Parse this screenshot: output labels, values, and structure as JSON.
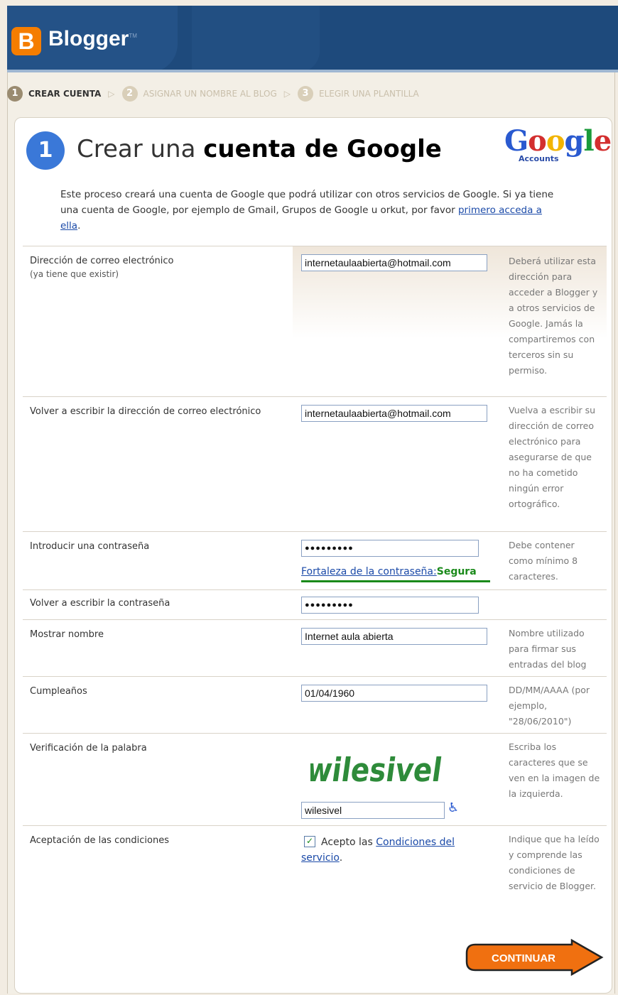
{
  "header": {
    "brand": "Blogger",
    "brand_tm": "TM",
    "logo_letter": "B"
  },
  "steps": [
    {
      "num": "1",
      "label": "CREAR CUENTA"
    },
    {
      "num": "2",
      "label": "ASIGNAR UN NOMBRE AL BLOG"
    },
    {
      "num": "3",
      "label": "ELEGIR UNA PLANTILLA"
    }
  ],
  "page": {
    "step_badge": "1",
    "title_prefix": "Crear una ",
    "title_bold": "cuenta de Google",
    "google_logo": "Google",
    "google_accounts": "Accounts",
    "intro_text": "Este proceso creará una cuenta de Google que podrá utilizar con otros servicios de Google. Si ya tiene una cuenta de Google, por ejemplo de Gmail, Grupos de Google u orkut, por favor ",
    "intro_link": "primero acceda a ella",
    "intro_end": "."
  },
  "form": {
    "email": {
      "label": "Dirección de correo electrónico",
      "sublabel": "(ya tiene que existir)",
      "value": "internetaulaabierta@hotmail.com",
      "help": "Deberá utilizar esta dirección para acceder a Blogger y a otros servicios de Google. Jamás la compartiremos con terceros sin su permiso."
    },
    "email_confirm": {
      "label": "Volver a escribir la dirección de correo electrónico",
      "value": "internetaulaabierta@hotmail.com",
      "help": "Vuelva a escribir su dirección de correo electrónico para asegurarse de que no ha cometido ningún error ortográfico."
    },
    "password": {
      "label": "Introducir una contraseña",
      "value": "●●●●●●●●●",
      "strength_label": "Fortaleza de la contraseña:",
      "strength_value": "Segura",
      "help": "Debe contener como mínimo 8 caracteres."
    },
    "password_confirm": {
      "label": "Volver a escribir la contraseña",
      "value": "●●●●●●●●●"
    },
    "display_name": {
      "label": "Mostrar nombre",
      "value": "Internet aula abierta",
      "help": "Nombre utilizado para firmar sus entradas del blog"
    },
    "birthday": {
      "label": "Cumpleaños",
      "value": "01/04/1960",
      "help": "DD/MM/AAAA (por ejemplo, \"28/06/2010\")"
    },
    "captcha": {
      "label": "Verificación de la palabra",
      "image_text": "wilesivel",
      "value": "wilesivel",
      "help": "Escriba los caracteres que se ven en la imagen de la izquierda."
    },
    "terms": {
      "label": "Aceptación de las condiciones",
      "accept_text": "Acepto las ",
      "terms_link": "Condiciones del servicio",
      "accept_end": ".",
      "checked": true,
      "help": "Indique que ha leído y comprende las condiciones de servicio de Blogger."
    }
  },
  "continue_label": "CONTINUAR"
}
